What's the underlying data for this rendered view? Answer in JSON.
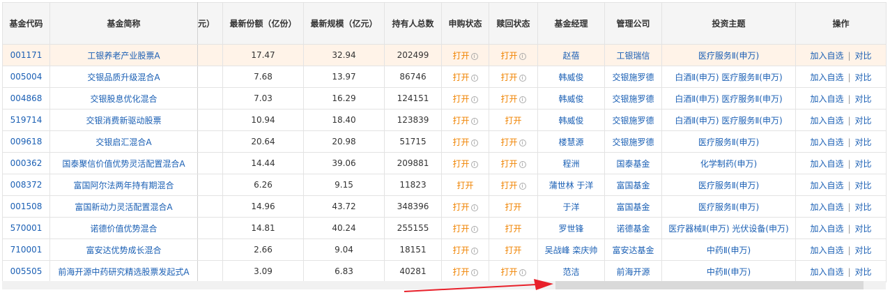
{
  "headers": [
    "基金代码",
    "基金简称",
    "元）",
    "最新份额（亿份）",
    "最新规模（亿元）",
    "持有人总数",
    "申购状态",
    "赎回状态",
    "基金经理",
    "管理公司",
    "投资主题",
    "操作"
  ],
  "rows": [
    {
      "code": "001171",
      "name": "工银养老产业股票A",
      "shares": "17.47",
      "scale": "32.94",
      "holders": "202499",
      "buy": "打开",
      "buy_info": true,
      "redeem": "打开",
      "redeem_info": true,
      "manager": "赵蓓",
      "company": "工银瑞信",
      "theme": "医疗服务Ⅱ(申万)"
    },
    {
      "code": "005004",
      "name": "交银品质升级混合A",
      "shares": "7.68",
      "scale": "13.97",
      "holders": "86746",
      "buy": "打开",
      "buy_info": true,
      "redeem": "打开",
      "redeem_info": true,
      "manager": "韩威俊",
      "company": "交银施罗德",
      "theme": "白酒Ⅱ(申万) 医疗服务Ⅱ(申万)"
    },
    {
      "code": "004868",
      "name": "交银股息优化混合",
      "shares": "7.03",
      "scale": "16.29",
      "holders": "124151",
      "buy": "打开",
      "buy_info": true,
      "redeem": "打开",
      "redeem_info": true,
      "manager": "韩威俊",
      "company": "交银施罗德",
      "theme": "白酒Ⅱ(申万) 医疗服务Ⅱ(申万)"
    },
    {
      "code": "519714",
      "name": "交银消费新驱动股票",
      "shares": "10.94",
      "scale": "18.40",
      "holders": "123839",
      "buy": "打开",
      "buy_info": true,
      "redeem": "打开",
      "redeem_info": false,
      "manager": "韩威俊",
      "company": "交银施罗德",
      "theme": "白酒Ⅱ(申万) 医疗服务Ⅱ(申万)"
    },
    {
      "code": "009618",
      "name": "交银启汇混合A",
      "shares": "20.64",
      "scale": "20.98",
      "holders": "51715",
      "buy": "打开",
      "buy_info": true,
      "redeem": "打开",
      "redeem_info": true,
      "manager": "楼慧源",
      "company": "交银施罗德",
      "theme": "医疗服务Ⅱ(申万)"
    },
    {
      "code": "000362",
      "name": "国泰聚信价值优势灵活配置混合A",
      "shares": "14.44",
      "scale": "39.06",
      "holders": "209881",
      "buy": "打开",
      "buy_info": true,
      "redeem": "打开",
      "redeem_info": true,
      "manager": "程洲",
      "company": "国泰基金",
      "theme": "化学制药(申万)"
    },
    {
      "code": "008372",
      "name": "富国阿尔法两年持有期混合",
      "shares": "6.26",
      "scale": "9.15",
      "holders": "11823",
      "buy": "打开",
      "buy_info": false,
      "redeem": "打开",
      "redeem_info": true,
      "manager": "蒲世林 于洋",
      "company": "富国基金",
      "theme": "医疗服务Ⅱ(申万)"
    },
    {
      "code": "001508",
      "name": "富国新动力灵活配置混合A",
      "shares": "14.96",
      "scale": "43.72",
      "holders": "348396",
      "buy": "打开",
      "buy_info": true,
      "redeem": "打开",
      "redeem_info": false,
      "manager": "于洋",
      "company": "富国基金",
      "theme": "医疗服务Ⅱ(申万)"
    },
    {
      "code": "570001",
      "name": "诺德价值优势混合",
      "shares": "14.81",
      "scale": "40.24",
      "holders": "255155",
      "buy": "打开",
      "buy_info": true,
      "redeem": "打开",
      "redeem_info": false,
      "manager": "罗世锋",
      "company": "诺德基金",
      "theme": "医疗器械Ⅱ(申万) 光伏设备(申万)"
    },
    {
      "code": "710001",
      "name": "富安达优势成长混合",
      "shares": "2.66",
      "scale": "9.04",
      "holders": "18151",
      "buy": "打开",
      "buy_info": true,
      "redeem": "打开",
      "redeem_info": false,
      "manager": "吴战峰 栾庆帅",
      "company": "富安达基金",
      "theme": "中药Ⅱ(申万)"
    },
    {
      "code": "005505",
      "name": "前海开源中药研究精选股票发起式A",
      "shares": "3.09",
      "scale": "6.83",
      "holders": "40281",
      "buy": "打开",
      "buy_info": true,
      "redeem": "打开",
      "redeem_info": true,
      "manager": "范洁",
      "company": "前海开源",
      "theme": "中药Ⅱ(申万)"
    }
  ],
  "actions": {
    "add": "加入自选",
    "sep": "|",
    "compare": "对比"
  },
  "info_glyph": "i",
  "colors": {
    "link": "#1a5fb4",
    "status": "#f08300",
    "highlight_row": "#fff3e8",
    "arrow": "#e8202a"
  }
}
